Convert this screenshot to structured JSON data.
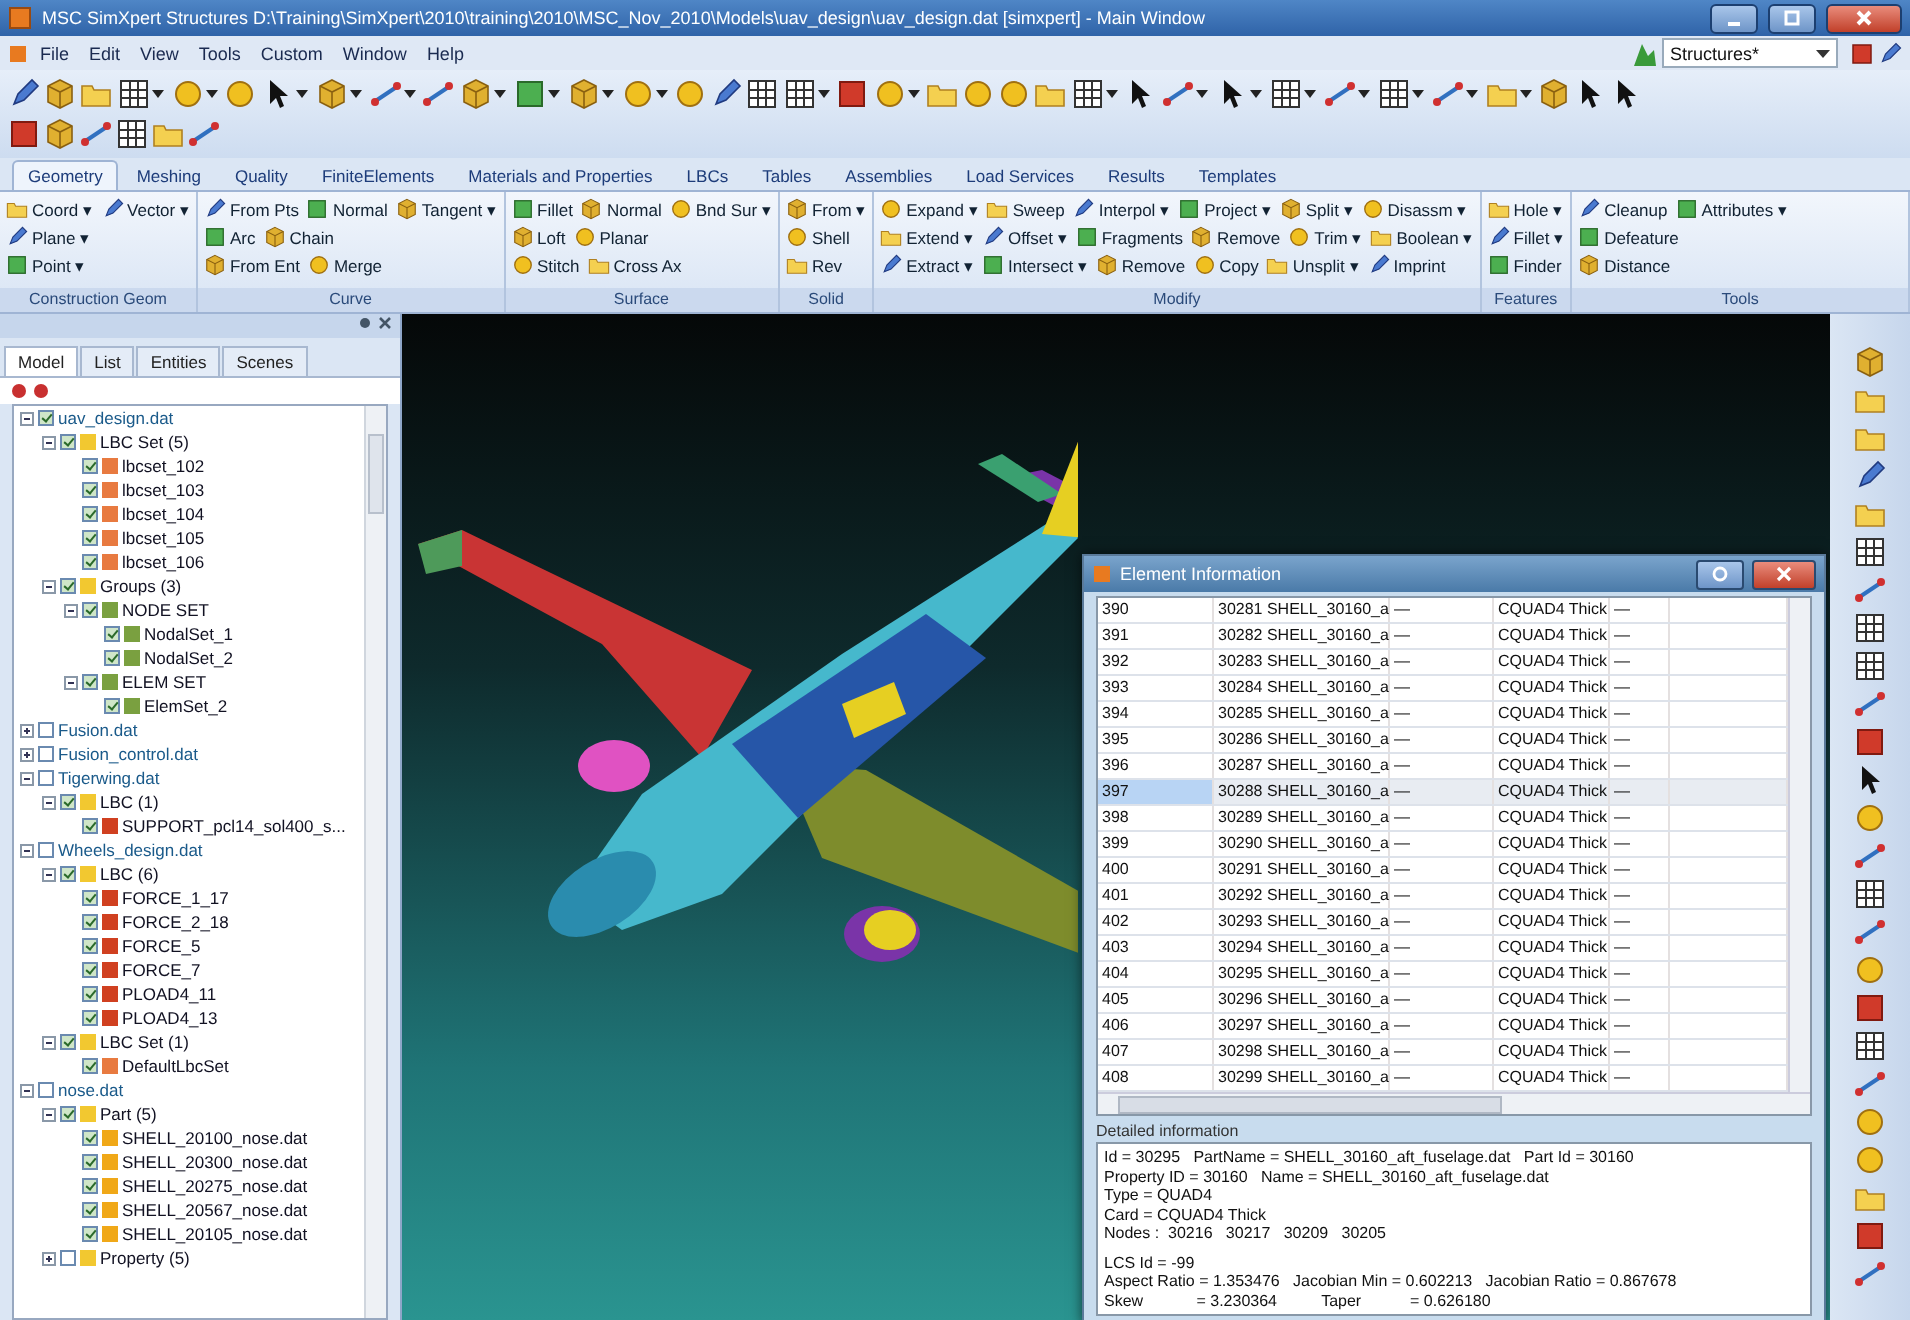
{
  "window": {
    "title": "MSC SimXpert Structures D:\\Training\\SimXpert\\2010\\training\\2010\\MSC_Nov_2010\\Models\\uav_design\\uav_design.dat [simxpert] - Main Window"
  },
  "menu_bar": [
    "File",
    "Edit",
    "View",
    "Tools",
    "Custom",
    "Window",
    "Help"
  ],
  "perspective": {
    "value": "Structures*"
  },
  "ribbon": {
    "tabs": [
      {
        "label": "Geometry",
        "selected": true
      },
      {
        "label": "Meshing",
        "selected": false
      },
      {
        "label": "Quality",
        "selected": false
      },
      {
        "label": "FiniteElements",
        "selected": false
      },
      {
        "label": "Materials and Properties",
        "selected": false
      },
      {
        "label": "LBCs",
        "selected": false
      },
      {
        "label": "Tables",
        "selected": false
      },
      {
        "label": "Assemblies",
        "selected": false
      },
      {
        "label": "Load Services",
        "selected": false
      },
      {
        "label": "Results",
        "selected": false
      },
      {
        "label": "Templates",
        "selected": false
      }
    ],
    "groups": [
      {
        "label": "Construction Geom",
        "rows": [
          [
            "Coord ▾",
            "Vector ▾"
          ],
          [
            "Plane ▾"
          ],
          [
            "Point ▾"
          ]
        ]
      },
      {
        "label": "Curve",
        "rows": [
          [
            "From Pts",
            "Normal",
            "Tangent ▾"
          ],
          [
            "Arc",
            "Chain"
          ],
          [
            "From Ent",
            "Merge"
          ]
        ]
      },
      {
        "label": "Surface",
        "rows": [
          [
            "Fillet",
            "Normal",
            "Bnd Sur ▾"
          ],
          [
            "Loft",
            "Planar"
          ],
          [
            "Stitch",
            "Cross Ax"
          ]
        ]
      },
      {
        "label": "Solid",
        "rows": [
          [
            "From ▾"
          ],
          [
            "Shell"
          ],
          [
            "Rev"
          ]
        ]
      },
      {
        "label": "Modify",
        "rows": [
          [
            "Expand ▾",
            "Sweep",
            "Interpol ▾",
            "Project ▾",
            "Split ▾",
            "Disassm ▾"
          ],
          [
            "Extend ▾",
            "Offset ▾",
            "Fragments",
            "Remove",
            "Trim ▾",
            "Boolean ▾"
          ],
          [
            "Extract ▾",
            "Intersect ▾",
            "Remove",
            "Copy",
            "Unsplit ▾",
            "Imprint"
          ]
        ]
      },
      {
        "label": "Features",
        "rows": [
          [
            "Hole ▾"
          ],
          [
            "Fillet ▾"
          ],
          [
            "Finder"
          ]
        ]
      },
      {
        "label": "Tools",
        "rows": [
          [
            "Cleanup",
            "Attributes ▾"
          ],
          [
            "Defeature"
          ],
          [
            "Distance"
          ]
        ]
      }
    ]
  },
  "model_panel": {
    "tabs": [
      {
        "label": "Model",
        "selected": true
      },
      {
        "label": "List",
        "selected": false
      },
      {
        "label": "Entities",
        "selected": false
      },
      {
        "label": "Scenes",
        "selected": false
      }
    ],
    "tree": [
      {
        "label": "uav_design.dat",
        "kind": "file",
        "checked": true,
        "expanded": true,
        "children": [
          {
            "label": "LBC Set (5)",
            "kind": "folder",
            "checked": true,
            "expanded": true,
            "children": [
              {
                "label": "lbcset_102",
                "kind": "lbcset",
                "checked": true
              },
              {
                "label": "lbcset_103",
                "kind": "lbcset",
                "checked": true
              },
              {
                "label": "lbcset_104",
                "kind": "lbcset",
                "checked": true
              },
              {
                "label": "lbcset_105",
                "kind": "lbcset",
                "checked": true
              },
              {
                "label": "lbcset_106",
                "kind": "lbcset",
                "checked": true
              }
            ]
          },
          {
            "label": "Groups (3)",
            "kind": "folder",
            "checked": true,
            "expanded": true,
            "children": [
              {
                "label": "NODE SET",
                "kind": "set",
                "checked": true,
                "expanded": true,
                "children": [
                  {
                    "label": "NodalSet_1",
                    "kind": "set",
                    "checked": true
                  },
                  {
                    "label": "NodalSet_2",
                    "kind": "set",
                    "checked": true
                  }
                ]
              },
              {
                "label": "ELEM SET",
                "kind": "set",
                "checked": true,
                "expanded": true,
                "children": [
                  {
                    "label": "ElemSet_2",
                    "kind": "set",
                    "checked": true
                  }
                ]
              }
            ]
          }
        ]
      },
      {
        "label": "Fusion.dat",
        "kind": "file",
        "checked": false,
        "expanded": false
      },
      {
        "label": "Fusion_control.dat",
        "kind": "file",
        "checked": false,
        "expanded": false
      },
      {
        "label": "Tigerwing.dat",
        "kind": "file",
        "checked": false,
        "expanded": true,
        "children": [
          {
            "label": "LBC (1)",
            "kind": "folder",
            "checked": true,
            "expanded": true,
            "children": [
              {
                "label": "SUPPORT_pcl14_sol400_s...",
                "kind": "load",
                "checked": true
              }
            ]
          }
        ]
      },
      {
        "label": "Wheels_design.dat",
        "kind": "file",
        "checked": false,
        "expanded": true,
        "children": [
          {
            "label": "LBC (6)",
            "kind": "folder",
            "checked": true,
            "expanded": true,
            "children": [
              {
                "label": "FORCE_1_17",
                "kind": "load",
                "checked": true
              },
              {
                "label": "FORCE_2_18",
                "kind": "load",
                "checked": true
              },
              {
                "label": "FORCE_5",
                "kind": "load",
                "checked": true
              },
              {
                "label": "FORCE_7",
                "kind": "load",
                "checked": true
              },
              {
                "label": "PLOAD4_11",
                "kind": "load",
                "checked": true
              },
              {
                "label": "PLOAD4_13",
                "kind": "load",
                "checked": true
              }
            ]
          },
          {
            "label": "LBC Set (1)",
            "kind": "folder",
            "checked": true,
            "expanded": true,
            "children": [
              {
                "label": "DefaultLbcSet",
                "kind": "lbcset",
                "checked": true
              }
            ]
          }
        ]
      },
      {
        "label": "nose.dat",
        "kind": "file",
        "checked": false,
        "expanded": true,
        "children": [
          {
            "label": "Part (5)",
            "kind": "folder",
            "checked": true,
            "expanded": true,
            "children": [
              {
                "label": "SHELL_20100_nose.dat",
                "kind": "part",
                "checked": true
              },
              {
                "label": "SHELL_20300_nose.dat",
                "kind": "part",
                "checked": true
              },
              {
                "label": "SHELL_20275_nose.dat",
                "kind": "part",
                "checked": true
              },
              {
                "label": "SHELL_20567_nose.dat",
                "kind": "part",
                "checked": true
              },
              {
                "label": "SHELL_20105_nose.dat",
                "kind": "part",
                "checked": true
              }
            ]
          },
          {
            "label": "Property (5)",
            "kind": "folder",
            "checked": false,
            "expanded": false
          }
        ]
      }
    ]
  },
  "info_dialog": {
    "title": "Element Information",
    "rows": [
      {
        "id": "390",
        "element": "30281 SHELL_30160_a",
        "column_3": "—",
        "card": "CQUAD4 Thick",
        "column_5": "—",
        "selected": false
      },
      {
        "id": "391",
        "element": "30282 SHELL_30160_a",
        "column_3": "—",
        "card": "CQUAD4 Thick",
        "column_5": "—",
        "selected": false
      },
      {
        "id": "392",
        "element": "30283 SHELL_30160_a",
        "column_3": "—",
        "card": "CQUAD4 Thick",
        "column_5": "—",
        "selected": false
      },
      {
        "id": "393",
        "element": "30284 SHELL_30160_a",
        "column_3": "—",
        "card": "CQUAD4 Thick",
        "column_5": "—",
        "selected": false
      },
      {
        "id": "394",
        "element": "30285 SHELL_30160_a",
        "column_3": "—",
        "card": "CQUAD4 Thick",
        "column_5": "—",
        "selected": false
      },
      {
        "id": "395",
        "element": "30286 SHELL_30160_a",
        "column_3": "—",
        "card": "CQUAD4 Thick",
        "column_5": "—",
        "selected": false
      },
      {
        "id": "396",
        "element": "30287 SHELL_30160_a",
        "column_3": "—",
        "card": "CQUAD4 Thick",
        "column_5": "—",
        "selected": false
      },
      {
        "id": "397",
        "element": "30288 SHELL_30160_a",
        "column_3": "—",
        "card": "CQUAD4 Thick",
        "column_5": "—",
        "selected": true
      },
      {
        "id": "398",
        "element": "30289 SHELL_30160_a",
        "column_3": "—",
        "card": "CQUAD4 Thick",
        "column_5": "—",
        "selected": false
      },
      {
        "id": "399",
        "element": "30290 SHELL_30160_a",
        "column_3": "—",
        "card": "CQUAD4 Thick",
        "column_5": "—",
        "selected": false
      },
      {
        "id": "400",
        "element": "30291 SHELL_30160_a",
        "column_3": "—",
        "card": "CQUAD4 Thick",
        "column_5": "—",
        "selected": false
      },
      {
        "id": "401",
        "element": "30292 SHELL_30160_a",
        "column_3": "—",
        "card": "CQUAD4 Thick",
        "column_5": "—",
        "selected": false
      },
      {
        "id": "402",
        "element": "30293 SHELL_30160_a",
        "column_3": "—",
        "card": "CQUAD4 Thick",
        "column_5": "—",
        "selected": false
      },
      {
        "id": "403",
        "element": "30294 SHELL_30160_a",
        "column_3": "—",
        "card": "CQUAD4 Thick",
        "column_5": "—",
        "selected": false
      },
      {
        "id": "404",
        "element": "30295 SHELL_30160_a",
        "column_3": "—",
        "card": "CQUAD4 Thick",
        "column_5": "—",
        "selected": false
      },
      {
        "id": "405",
        "element": "30296 SHELL_30160_a",
        "column_3": "—",
        "card": "CQUAD4 Thick",
        "column_5": "—",
        "selected": false
      },
      {
        "id": "406",
        "element": "30297 SHELL_30160_a",
        "column_3": "—",
        "card": "CQUAD4 Thick",
        "column_5": "—",
        "selected": false
      },
      {
        "id": "407",
        "element": "30298 SHELL_30160_a",
        "column_3": "—",
        "card": "CQUAD4 Thick",
        "column_5": "—",
        "selected": false
      },
      {
        "id": "408",
        "element": "30299 SHELL_30160_a",
        "column_3": "—",
        "card": "CQUAD4 Thick",
        "column_5": "—",
        "selected": false
      }
    ],
    "details_label": "Detailed information",
    "details": [
      [
        "Id = 30295   PartName = SHELL_30160_aft_fuselage.dat   Part Id = 30160",
        "Property ID = 30160   Name = SHELL_30160_aft_fuselage.dat",
        "Type = QUAD4",
        "Card = CQUAD4 Thick",
        "Nodes :  30216   30217   30209   30205"
      ],
      [
        "LCS Id = -99",
        "Aspect Ratio = 1.353476   Jacobian Min = 0.602213   Jacobian Ratio = 0.867678",
        "Skew            = 3.230364          Taper           = 0.626180"
      ]
    ]
  }
}
